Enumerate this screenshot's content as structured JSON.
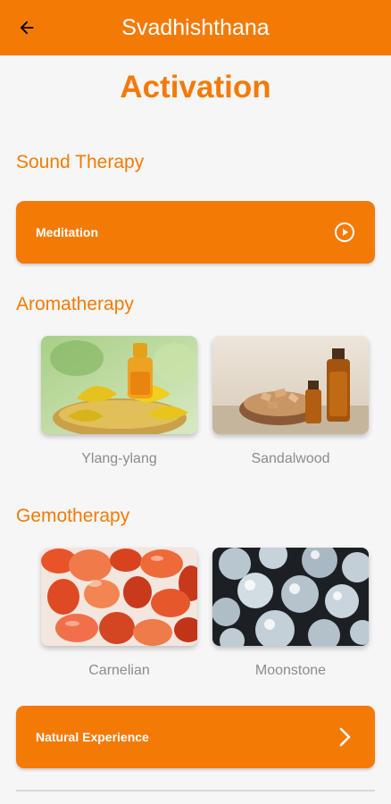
{
  "appbar": {
    "title": "Svadhishthana",
    "back_icon": "arrow-left-icon"
  },
  "page": {
    "title": "Activation"
  },
  "sound_therapy": {
    "title": "Sound Therapy",
    "button_label": "Meditation",
    "button_icon": "play-circle-icon"
  },
  "aromatherapy": {
    "title": "Aromatherapy",
    "items": [
      {
        "label": "Ylang-ylang"
      },
      {
        "label": "Sandalwood"
      }
    ]
  },
  "gemotherapy": {
    "title": "Gemotherapy",
    "items": [
      {
        "label": "Carnelian"
      },
      {
        "label": "Moonstone"
      }
    ]
  },
  "natural_experience": {
    "button_label": "Natural Experience",
    "button_icon": "chevron-right-icon"
  },
  "colors": {
    "accent": "#f47a06",
    "caption": "#8c8c8c",
    "background": "#f6f6f6"
  }
}
